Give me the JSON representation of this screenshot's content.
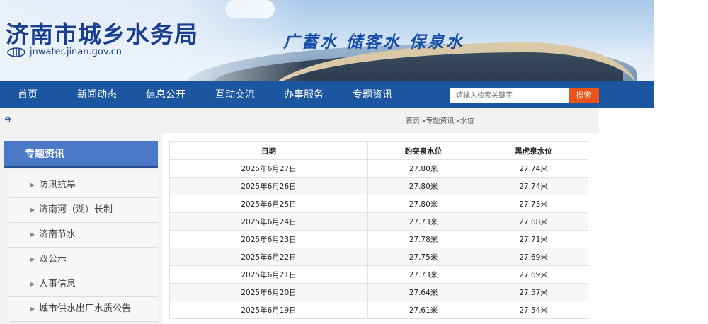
{
  "header": {
    "site_title": "济南市城乡水务局",
    "site_domain": "jnwater.jinan.gov.cn",
    "slogan": "广蓄水  储客水  保泉水"
  },
  "nav": {
    "items": [
      {
        "label": "首页"
      },
      {
        "label": "新闻动态"
      },
      {
        "label": "信息公开"
      },
      {
        "label": "互动交流"
      },
      {
        "label": "办事服务"
      },
      {
        "label": "专题资讯"
      }
    ]
  },
  "search": {
    "placeholder": "请输入检索关键字",
    "button_label": "搜索"
  },
  "breadcrumb": "首页>专题资讯>水位",
  "sidebar": {
    "title": "专题资讯",
    "items": [
      {
        "label": "防汛抗旱"
      },
      {
        "label": "济南河（湖）长制"
      },
      {
        "label": "济南节水"
      },
      {
        "label": "双公示"
      },
      {
        "label": "人事信息"
      },
      {
        "label": "城市供水出厂水质公告"
      }
    ]
  },
  "table": {
    "headers": [
      "日期",
      "趵突泉水位",
      "黑虎泉水位"
    ],
    "rows": [
      [
        "2025年6月27日",
        "27.80米",
        "27.74米"
      ],
      [
        "2025年6月26日",
        "27.80米",
        "27.74米"
      ],
      [
        "2025年6月25日",
        "27.80米",
        "27.73米"
      ],
      [
        "2025年6月24日",
        "27.73米",
        "27.68米"
      ],
      [
        "2025年6月23日",
        "27.78米",
        "27.71米"
      ],
      [
        "2025年6月22日",
        "27.75米",
        "27.69米"
      ],
      [
        "2025年6月21日",
        "27.73米",
        "27.69米"
      ],
      [
        "2025年6月20日",
        "27.64米",
        "27.57米"
      ],
      [
        "2025年6月19日",
        "27.61米",
        "27.54米"
      ]
    ]
  },
  "colors": {
    "nav_bg": "#1c56a0",
    "sidebar_header_bg": "#4a78c6",
    "search_button_bg": "#e8541a",
    "title_blue": "#1a3f8f"
  }
}
